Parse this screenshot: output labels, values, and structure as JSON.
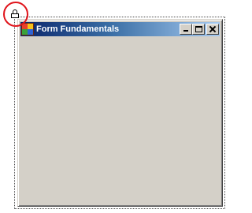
{
  "window": {
    "title": "Form Fundamentals"
  },
  "icons": {
    "app": "app-icon",
    "lock": "lock-icon",
    "minimize": "minimize-icon",
    "maximize": "maximize-icon",
    "close": "close-icon"
  },
  "colors": {
    "title_gradient_start": "#0a246a",
    "title_gradient_end": "#a6caf0",
    "window_face": "#d4d0c8",
    "highlight_circle": "#e0141b"
  }
}
